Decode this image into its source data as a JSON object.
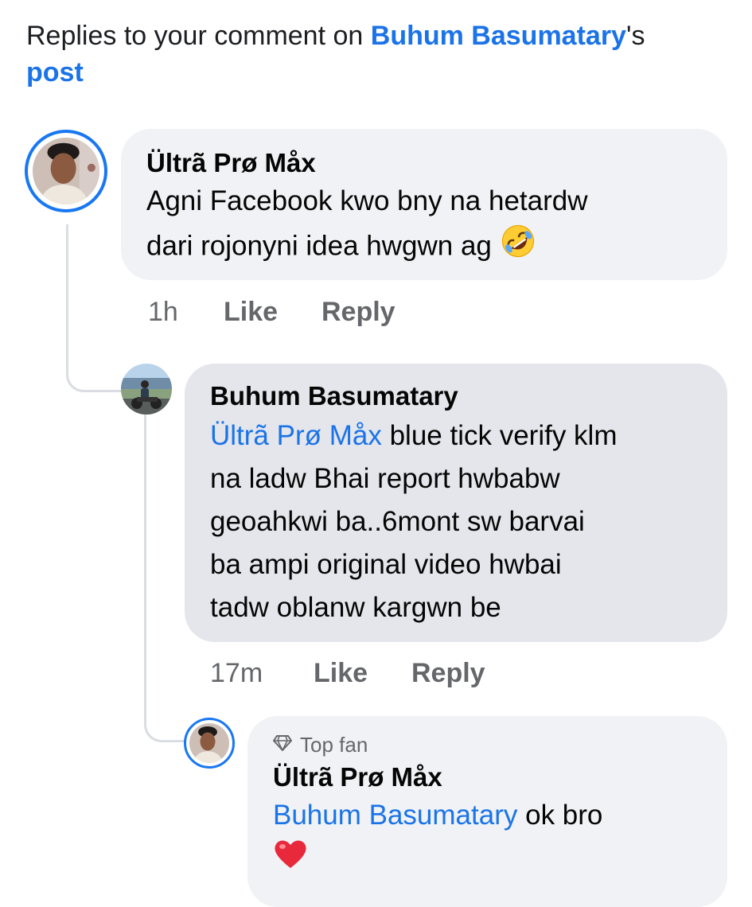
{
  "header": {
    "prefix": "Replies to your comment on ",
    "author": "Buhum Basumatary",
    "possessive": "'s",
    "post_link": "post"
  },
  "comments": [
    {
      "author": "Ültrã Prø Måx",
      "line1": "Agni Facebook kwo bny na hetardw",
      "line2": "dari rojonyni idea hwgwn ag",
      "emoji": "rolling-on-floor-laughing",
      "time": "1h",
      "like": "Like",
      "reply": "Reply"
    },
    {
      "author": "Buhum Basumatary",
      "mention": "Ültrã Prø Måx",
      "line1": " blue tick verify klm",
      "line2": "na ladw Bhai report hwbabw",
      "line3": "geoahkwi ba..6mont sw barvai",
      "line4": "ba ampi original video hwbai",
      "line5": "tadw oblanw kargwn be",
      "time": "17m",
      "like": "Like",
      "reply": "Reply"
    },
    {
      "badge_icon": "diamond-icon",
      "badge": "Top fan",
      "author": "Ültrã Prø Måx",
      "mention": "Buhum Basumatary",
      "text": " ok bro",
      "emoji": "red-heart"
    }
  ],
  "colors": {
    "link": "#1a73e8",
    "ring": "#1877f2",
    "bubble_light": "#f0f2f5",
    "bubble_dark": "#e4e6eb",
    "muted": "#65676b"
  }
}
